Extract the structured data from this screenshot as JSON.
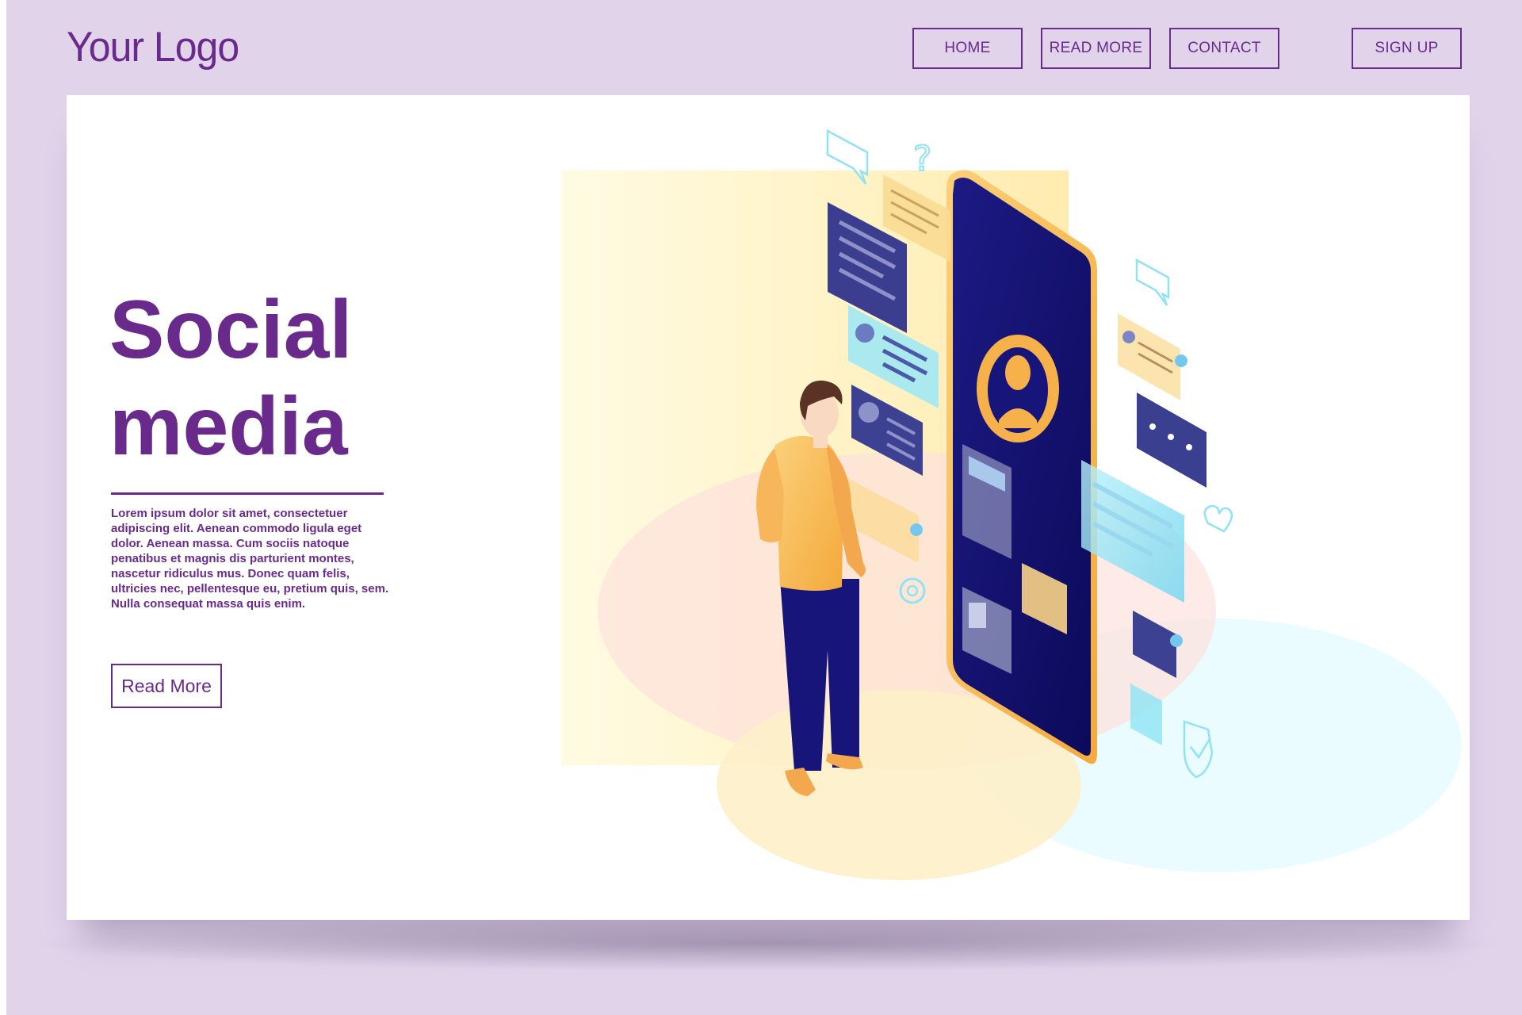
{
  "header": {
    "logo": "Your Logo",
    "nav": [
      {
        "label": "HOME"
      },
      {
        "label": "READ MORE"
      },
      {
        "label": "CONTACT"
      },
      {
        "label": "SIGN UP"
      }
    ]
  },
  "hero": {
    "title": "Social\nmedia",
    "body": "Lorem ipsum dolor sit amet, consectetuer adipiscing elit. Aenean commodo ligula eget dolor. Aenean massa. Cum sociis natoque penatibus et magnis dis parturient montes, nascetur ridiculus mus. Donec quam felis, ultricies nec, pellentesque eu, pretium quis, sem. Nulla consequat massa quis enim.",
    "button_label": "Read More"
  },
  "illustration": {
    "icons": [
      "person-icon",
      "smartphone-icon",
      "avatar-icon",
      "chat-bubble-icon",
      "question-mark-icon",
      "gear-icon",
      "heart-icon",
      "shield-check-icon"
    ]
  },
  "colors": {
    "background": "#e0d3ea",
    "brand": "#6a2a8c",
    "phone": "#1b1a7a",
    "accent_orange": "#f6b14b",
    "accent_cyan": "#8fe3f5"
  }
}
